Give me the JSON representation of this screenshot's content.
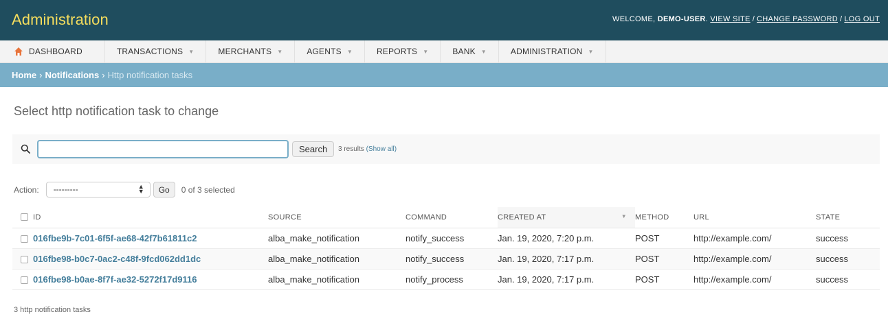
{
  "header": {
    "brand": "Administration",
    "welcome": "Welcome,",
    "username": "demo-user",
    "view_site": "View site",
    "change_password": "Change password",
    "log_out": "Log out",
    "separator": "/"
  },
  "nav": {
    "items": [
      {
        "label": "Dashboard",
        "icon": "home-icon"
      },
      {
        "label": "Transactions"
      },
      {
        "label": "Merchants"
      },
      {
        "label": "Agents"
      },
      {
        "label": "Reports"
      },
      {
        "label": "Bank"
      },
      {
        "label": "Administration"
      }
    ],
    "caret": "▼"
  },
  "breadcrumbs": {
    "home": "Home",
    "section": "Notifications",
    "current": "Http notification tasks",
    "separator": "›"
  },
  "page": {
    "title": "Select http notification task to change"
  },
  "search": {
    "value": "",
    "button": "Search",
    "results_text": "3 results",
    "show_all": "(Show all)"
  },
  "actions": {
    "label": "Action:",
    "selected_option": "---------",
    "go": "Go",
    "selected_count": "0 of 3 selected"
  },
  "table": {
    "columns": [
      "ID",
      "Source",
      "Command",
      "Created at",
      "Method",
      "URL",
      "State"
    ],
    "sorted_column": "Created at",
    "rows": [
      {
        "id": "016fbe9b-7c01-6f5f-ae68-42f7b61811c2",
        "source": "alba_make_notification",
        "command": "notify_success",
        "created_at": "Jan. 19, 2020, 7:20 p.m.",
        "method": "POST",
        "url": "http://example.com/",
        "state": "success"
      },
      {
        "id": "016fbe98-b0c7-0ac2-c48f-9fcd062dd1dc",
        "source": "alba_make_notification",
        "command": "notify_success",
        "created_at": "Jan. 19, 2020, 7:17 p.m.",
        "method": "POST",
        "url": "http://example.com/",
        "state": "success"
      },
      {
        "id": "016fbe98-b0ae-8f7f-ae32-5272f17d9116",
        "source": "alba_make_notification",
        "command": "notify_process",
        "created_at": "Jan. 19, 2020, 7:17 p.m.",
        "method": "POST",
        "url": "http://example.com/",
        "state": "success"
      }
    ]
  },
  "footer": {
    "count_text": "3 http notification tasks"
  },
  "colors": {
    "header_bg": "#1f4d5e",
    "brand": "#f5dd5d",
    "breadcrumb_bg": "#79aec8",
    "link": "#447e9b"
  }
}
